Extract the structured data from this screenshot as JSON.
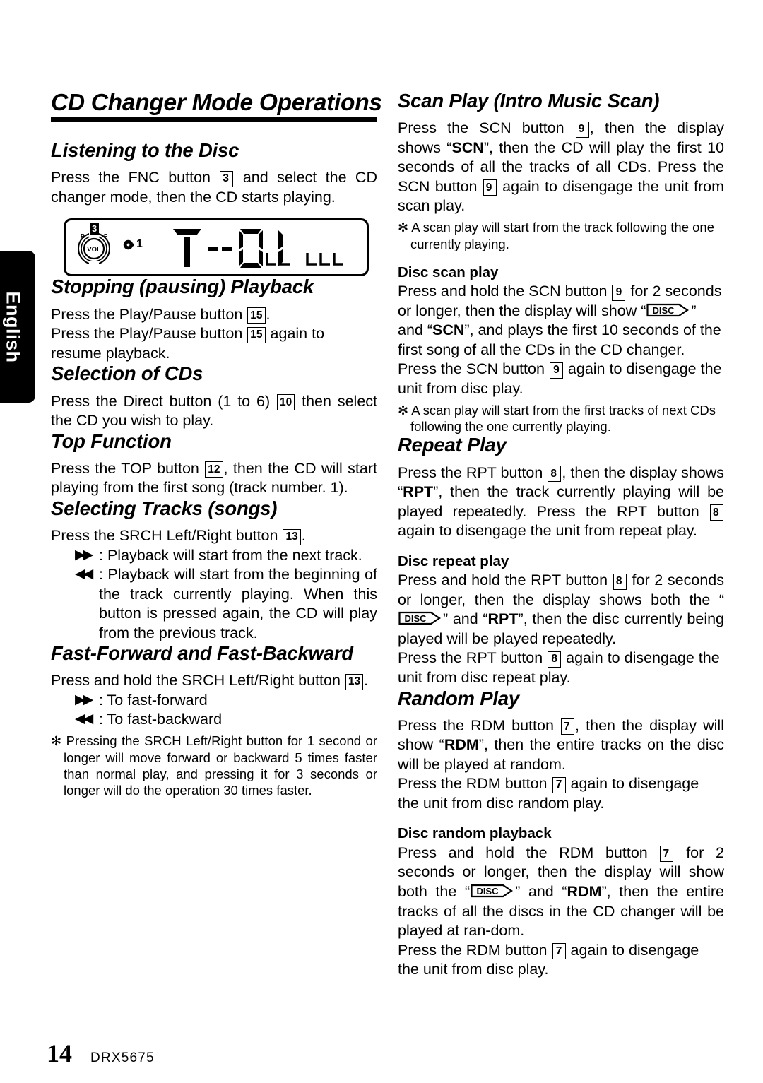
{
  "language_tab": {
    "label": "English"
  },
  "header": {
    "title": "CD Changer Mode Operations"
  },
  "footer": {
    "page_number": "14",
    "model": "DRX5675"
  },
  "lcd_display": {
    "knob_label": "VOL",
    "knob_rear_label": "R",
    "knob_front_label": "F",
    "disc_number": "1",
    "main_readout": "T - 01",
    "segment_highlight": "3"
  },
  "left_column": {
    "listening": {
      "heading": "Listening to the Disc",
      "text_1": "Press the FNC button",
      "ref_1": "3",
      "text_2": "and select the CD changer mode, then the CD starts playing."
    },
    "stopping": {
      "heading": "Stopping (pausing) Playback",
      "line1_a": "Press the Play/Pause button",
      "line1_ref": "15",
      "line1_b": ".",
      "line2_a": "Press the Play/Pause button",
      "line2_ref": "15",
      "line2_b": "again to resume playback."
    },
    "selection": {
      "heading": "Selection of CDs",
      "text_1": "Press the Direct button (1 to 6)",
      "ref_1": "10",
      "text_2": "then select the CD you wish to play."
    },
    "top_function": {
      "heading": "Top Function",
      "text_1": "Press the TOP button",
      "ref_1": "12",
      "text_2": ", then the CD will start playing from the first song (track number. 1)."
    },
    "selecting_tracks": {
      "heading": "Selecting Tracks (songs)",
      "text_1": "Press the SRCH Left/Right button",
      "ref_1": "13",
      "text_2": ".",
      "forward_glyph": "▶▶",
      "forward_text": ": Playback will start from the next track.",
      "backward_glyph": "◀◀",
      "backward_text": ": Playback will start from the beginning of the track currently playing. When this button is pressed again, the CD will play from the previous track."
    },
    "fast_forward": {
      "heading": "Fast-Forward and Fast-Backward",
      "text_1": "Press and hold the SRCH Left/Right button",
      "ref_1": "13",
      "text_2": ".",
      "forward_glyph": "▶▶",
      "forward_text": ": To fast-forward",
      "backward_glyph": "◀◀",
      "backward_text": ": To fast-backward",
      "note": "Pressing the SRCH Left/Right button for 1 second or longer will move forward or backward 5 times faster than normal play, and pressing it for 3 seconds or longer will do the operation 30 times faster."
    }
  },
  "right_column": {
    "scan_play": {
      "heading": "Scan Play (Intro Music Scan)",
      "text_1": "Press the SCN button",
      "ref_1": "9",
      "text_2": ", then the display shows “",
      "display_word": "SCN",
      "text_3": "”, then the CD will play the first 10 seconds of all the tracks of all CDs. Press the SCN button",
      "ref_2": "9",
      "text_4": "again to disengage the unit from scan play.",
      "note": "A scan play will start from the track following the one currently playing."
    },
    "disc_scan_play": {
      "heading": "Disc scan play",
      "text_1": "Press and hold the SCN button",
      "ref_1": "9",
      "text_2": "for 2 seconds or longer, then the display will show “",
      "disc_icon_label": "DISC",
      "text_3": "” and “",
      "display_word": "SCN",
      "text_4": "”, and plays the first 10 seconds of the first song of all the CDs in the CD changer.",
      "text_5": "Press the SCN button",
      "ref_2": "9",
      "text_6": "again to disengage the unit from disc play.",
      "note": "A scan play will start from the first tracks of next CDs following the one currently playing."
    },
    "repeat_play": {
      "heading": "Repeat Play",
      "text_1": "Press the RPT button",
      "ref_1": "8",
      "text_2": ", then the display shows “",
      "display_word": "RPT",
      "text_3": "”, then the track currently playing will be played repeatedly. Press the RPT button",
      "ref_2": "8",
      "text_4": "again to disengage the unit from repeat play."
    },
    "disc_repeat_play": {
      "heading": "Disc repeat play",
      "text_1": "Press and hold the RPT button",
      "ref_1": "8",
      "text_2": "for 2 seconds or longer, then the display shows both the “",
      "disc_icon_label": "DISC",
      "text_3": "” and “",
      "display_word": "RPT",
      "text_4": "”, then the disc currently being played will be played repeatedly.",
      "text_5": "Press the RPT button",
      "ref_2": "8",
      "text_6": "again to disengage the unit from disc repeat play."
    },
    "random_play": {
      "heading": "Random Play",
      "text_1": "Press the RDM button",
      "ref_1": "7",
      "text_2": ", then the display will show “",
      "display_word": "RDM",
      "text_3": "”, then the entire tracks on the disc will be played at random.",
      "text_4": "Press the RDM button",
      "ref_2": "7",
      "text_5": "again to disengage the unit from disc random play."
    },
    "disc_random_playback": {
      "heading": "Disc random playback",
      "text_1": "Press and hold the RDM button",
      "ref_1": "7",
      "text_2": "for 2 seconds or longer, then the display will show both the “",
      "disc_icon_label": "DISC",
      "text_3": "” and “",
      "display_word": "RDM",
      "text_4": "”, then the entire tracks of all the discs in the CD changer will be played at ran-dom.",
      "text_5": "Press the RDM button",
      "ref_2": "7",
      "text_6": "again to disengage the unit from disc play."
    }
  }
}
